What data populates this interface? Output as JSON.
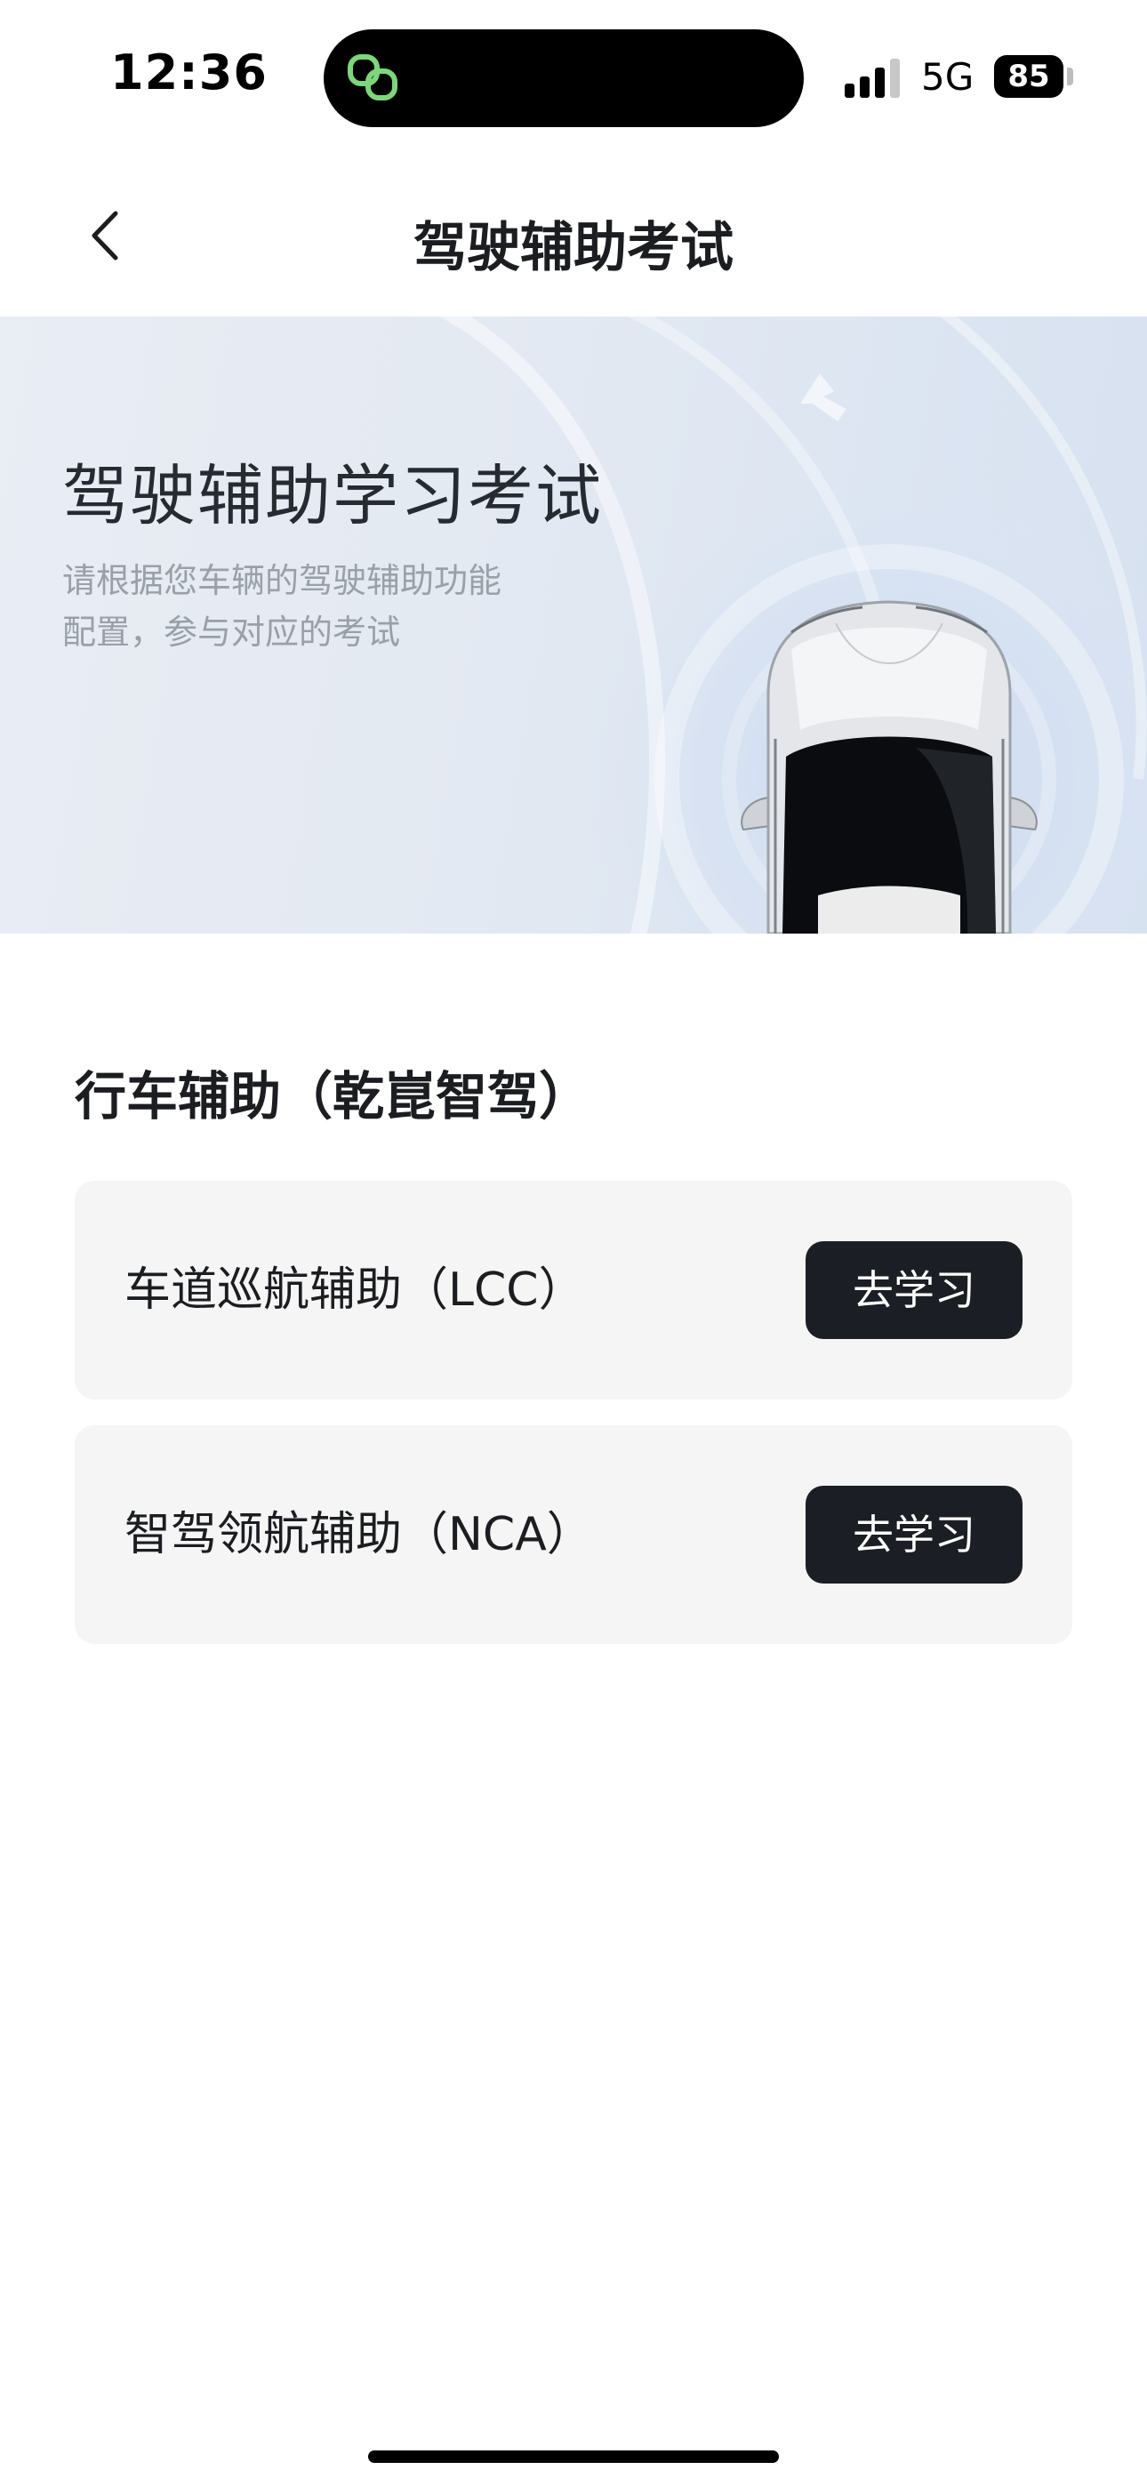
{
  "status_bar": {
    "time": "12:36",
    "network": "5G",
    "battery_level": "85",
    "island_icon": "linked-rings-icon",
    "signal_icon": "cellular-signal-icon",
    "colors": {
      "island_icon": "#7ed67a"
    }
  },
  "nav": {
    "title": "驾驶辅助考试",
    "back_icon": "chevron-left-icon"
  },
  "hero": {
    "title": "驾驶辅助学习考试",
    "subtitle_line1": "请根据您车辆的驾驶辅助功能",
    "subtitle_line2": "配置，参与对应的考试",
    "image": "car-top-view-illustration"
  },
  "section": {
    "title": "行车辅助（乾崑智驾）",
    "items": [
      {
        "name": "车道巡航辅助（LCC）",
        "action_label": "去学习"
      },
      {
        "name": "智驾领航辅助（NCA）",
        "action_label": "去学习"
      }
    ]
  },
  "colors": {
    "primary_button_bg": "#1c1e25",
    "card_bg": "#f5f5f5",
    "hero_bg": "#e3e9f2"
  }
}
